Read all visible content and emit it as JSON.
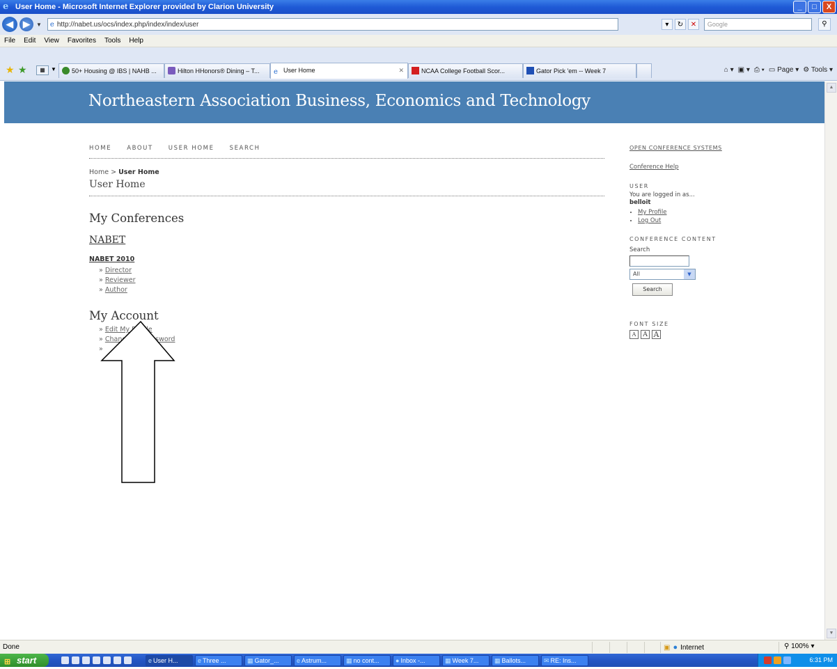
{
  "window": {
    "title": "User Home - Microsoft Internet Explorer provided by Clarion University",
    "buttons": {
      "minimize": "_",
      "maximize": "□",
      "close": "X"
    }
  },
  "address_bar": {
    "url": "http://nabet.us/ocs/index.php/index/index/user",
    "search_placeholder": "Google"
  },
  "menu": [
    "File",
    "Edit",
    "View",
    "Favorites",
    "Tools",
    "Help"
  ],
  "tabs": [
    {
      "label": "50+ Housing @ IBS | NAHB ...",
      "active": false,
      "icon_color": "#3a8a2a"
    },
    {
      "label": "Hilton HHonors® Dining – T...",
      "active": false,
      "icon_color": "#7a5bbd"
    },
    {
      "label": "User Home",
      "active": true,
      "icon_color": "#2b6fd0"
    },
    {
      "label": "NCAA College Football Scor...",
      "active": false,
      "icon_color": "#d42020"
    },
    {
      "label": "Gator Pick 'em -- Week 7",
      "active": false,
      "icon_color": "#1f4fb4"
    }
  ],
  "command_bar": {
    "page": "Page",
    "tools": "Tools"
  },
  "site": {
    "title": "Northeastern Association Business, Economics and Technology",
    "header_color": "#4a80b4",
    "nav": [
      "HOME",
      "ABOUT",
      "USER HOME",
      "SEARCH"
    ],
    "breadcrumb": {
      "home": "Home",
      "separator": ">",
      "current": "User Home"
    },
    "page_title": "User Home",
    "my_conferences": {
      "heading": "My Conferences",
      "conference": "NABET",
      "schedule": "NABET 2010",
      "roles": [
        "Director",
        "Reviewer",
        "Author"
      ]
    },
    "my_account": {
      "heading": "My Account",
      "links": [
        "Edit My Profile",
        "Change My Password",
        ""
      ]
    },
    "sidebar": {
      "ocs": "OPEN CONFERENCE SYSTEMS",
      "help": "Conference Help",
      "user_heading": "USER",
      "logged_in": "You are logged in as...",
      "username": "belloit",
      "user_links": [
        "My Profile",
        "Log Out"
      ],
      "content_heading": "CONFERENCE CONTENT",
      "search_label": "Search",
      "search_scope": "All",
      "search_button": "Search",
      "font_heading": "FONT SIZE",
      "font_buttons": [
        "A",
        "A",
        "A"
      ]
    }
  },
  "status_bar": {
    "status": "Done",
    "zone": "Internet",
    "zoom": "100%"
  },
  "taskbar": {
    "start": "start",
    "tasks": [
      "User H...",
      "Three ...",
      "Gator_...",
      "Astrum...",
      "no cont...",
      "Inbox -...",
      "Week 7...",
      "Ballots...",
      "RE: Ins..."
    ],
    "clock": "6:31 PM"
  }
}
